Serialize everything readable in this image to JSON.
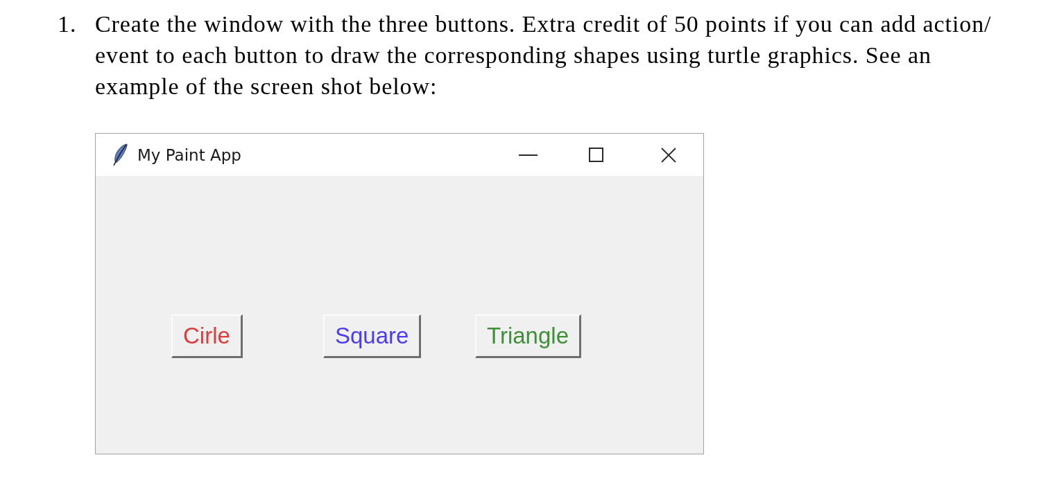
{
  "question": {
    "number": "1.",
    "text": "Create the window with the three buttons. Extra credit of 50 points if you can add action/ event to each button to draw the corresponding shapes using turtle graphics. See an example of the screen shot below:"
  },
  "window": {
    "title": "My Paint App",
    "buttons": [
      {
        "label": "Cirle",
        "color": "#dc3c3c"
      },
      {
        "label": "Square",
        "color": "#4b3cf0"
      },
      {
        "label": "Triangle",
        "color": "#3f8f3a"
      }
    ]
  }
}
